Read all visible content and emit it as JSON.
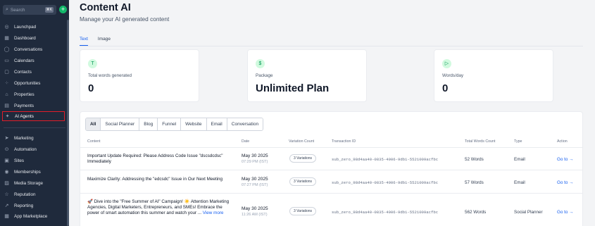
{
  "sidebar": {
    "search_placeholder": "Search",
    "search_shortcut": "⌘K",
    "items": [
      {
        "label": "Launchpad",
        "icon": "launchpad-icon",
        "glyph": "◎"
      },
      {
        "label": "Dashboard",
        "icon": "dashboard-icon",
        "glyph": "▦"
      },
      {
        "label": "Conversations",
        "icon": "chat-icon",
        "glyph": "◯"
      },
      {
        "label": "Calendars",
        "icon": "calendar-icon",
        "glyph": "▭"
      },
      {
        "label": "Contacts",
        "icon": "contacts-icon",
        "glyph": "▢"
      },
      {
        "label": "Opportunities",
        "icon": "opportunities-icon",
        "glyph": "⁘"
      },
      {
        "label": "Properties",
        "icon": "home-icon",
        "glyph": "⌂"
      },
      {
        "label": "Payments",
        "icon": "payments-icon",
        "glyph": "▤"
      },
      {
        "label": "AI Agents",
        "icon": "ai-agents-icon",
        "glyph": "✦"
      }
    ],
    "items2": [
      {
        "label": "Marketing",
        "icon": "send-icon",
        "glyph": "➤"
      },
      {
        "label": "Automation",
        "icon": "automation-icon",
        "glyph": "⊙"
      },
      {
        "label": "Sites",
        "icon": "sites-icon",
        "glyph": "▣"
      },
      {
        "label": "Memberships",
        "icon": "memberships-icon",
        "glyph": "◉"
      },
      {
        "label": "Media Storage",
        "icon": "media-icon",
        "glyph": "▨"
      },
      {
        "label": "Reputation",
        "icon": "star-icon",
        "glyph": "☆"
      },
      {
        "label": "Reporting",
        "icon": "reporting-icon",
        "glyph": "↗"
      },
      {
        "label": "App Marketplace",
        "icon": "marketplace-icon",
        "glyph": "▦"
      }
    ]
  },
  "header": {
    "title": "Content AI",
    "subtitle": "Manage your AI generated content"
  },
  "tabs": [
    {
      "label": "Text"
    },
    {
      "label": "Image"
    }
  ],
  "stats": [
    {
      "label": "Total words generated",
      "value": "0",
      "icon": "text-icon",
      "glyph": "T"
    },
    {
      "label": "Package",
      "value": "Unlimited Plan",
      "icon": "dollar-icon",
      "glyph": "$"
    },
    {
      "label": "Words/day",
      "value": "0",
      "icon": "words-day-icon",
      "glyph": "▷"
    }
  ],
  "filters": [
    "All",
    "Social Planner",
    "Blog",
    "Funnel",
    "Website",
    "Email",
    "Conversation"
  ],
  "table": {
    "headers": {
      "content": "Content",
      "date": "Date",
      "variations": "Variation Count",
      "transaction": "Transaction ID",
      "words": "Total Words Count",
      "type": "Type",
      "action": "Action"
    },
    "rows": [
      {
        "content": "Important Update Required: Please Address Code Issue \"dscsdcdsc\" Immediately",
        "date": "May 30 2025",
        "time": "07:29 PM (IST)",
        "variations": "3 Variations",
        "transaction": "sub_zero_98d4aa40-0835-4906-9db1-5521009acfbc",
        "words": "52 Words",
        "type": "Email",
        "action": "Go to →"
      },
      {
        "content": "Maximize Clarity: Addressing the \"edcsdc\" Issue in Our Next Meeting",
        "date": "May 30 2025",
        "time": "07:27 PM (IST)",
        "variations": "3 Variations",
        "transaction": "sub_zero_98d4aa40-0835-4906-9db1-5521009acfbc",
        "words": "57 Words",
        "type": "Email",
        "action": "Go to →"
      },
      {
        "content": "🚀 Dive into the \"Free Summer of AI\" Campaign! ☀️ Attention Marketing Agencies, Digital Marketers, Entrepreneurs, and SMEs! Embrace the power of smart automation this summer and watch your ...",
        "more": "View more",
        "date": "May 30 2025",
        "time": "11:26 AM (IST)",
        "variations": "3 Variations",
        "transaction": "sub_zero_98d4aa40-0835-4906-9db1-5521009acfbc",
        "words": "562 Words",
        "type": "Social Planner",
        "action": "Go to →"
      }
    ]
  },
  "colors": {
    "sidebar_bg": "#1f2a3c",
    "accent": "#155eef",
    "highlight_border": "#e11d29",
    "icon_green": "#039855"
  }
}
